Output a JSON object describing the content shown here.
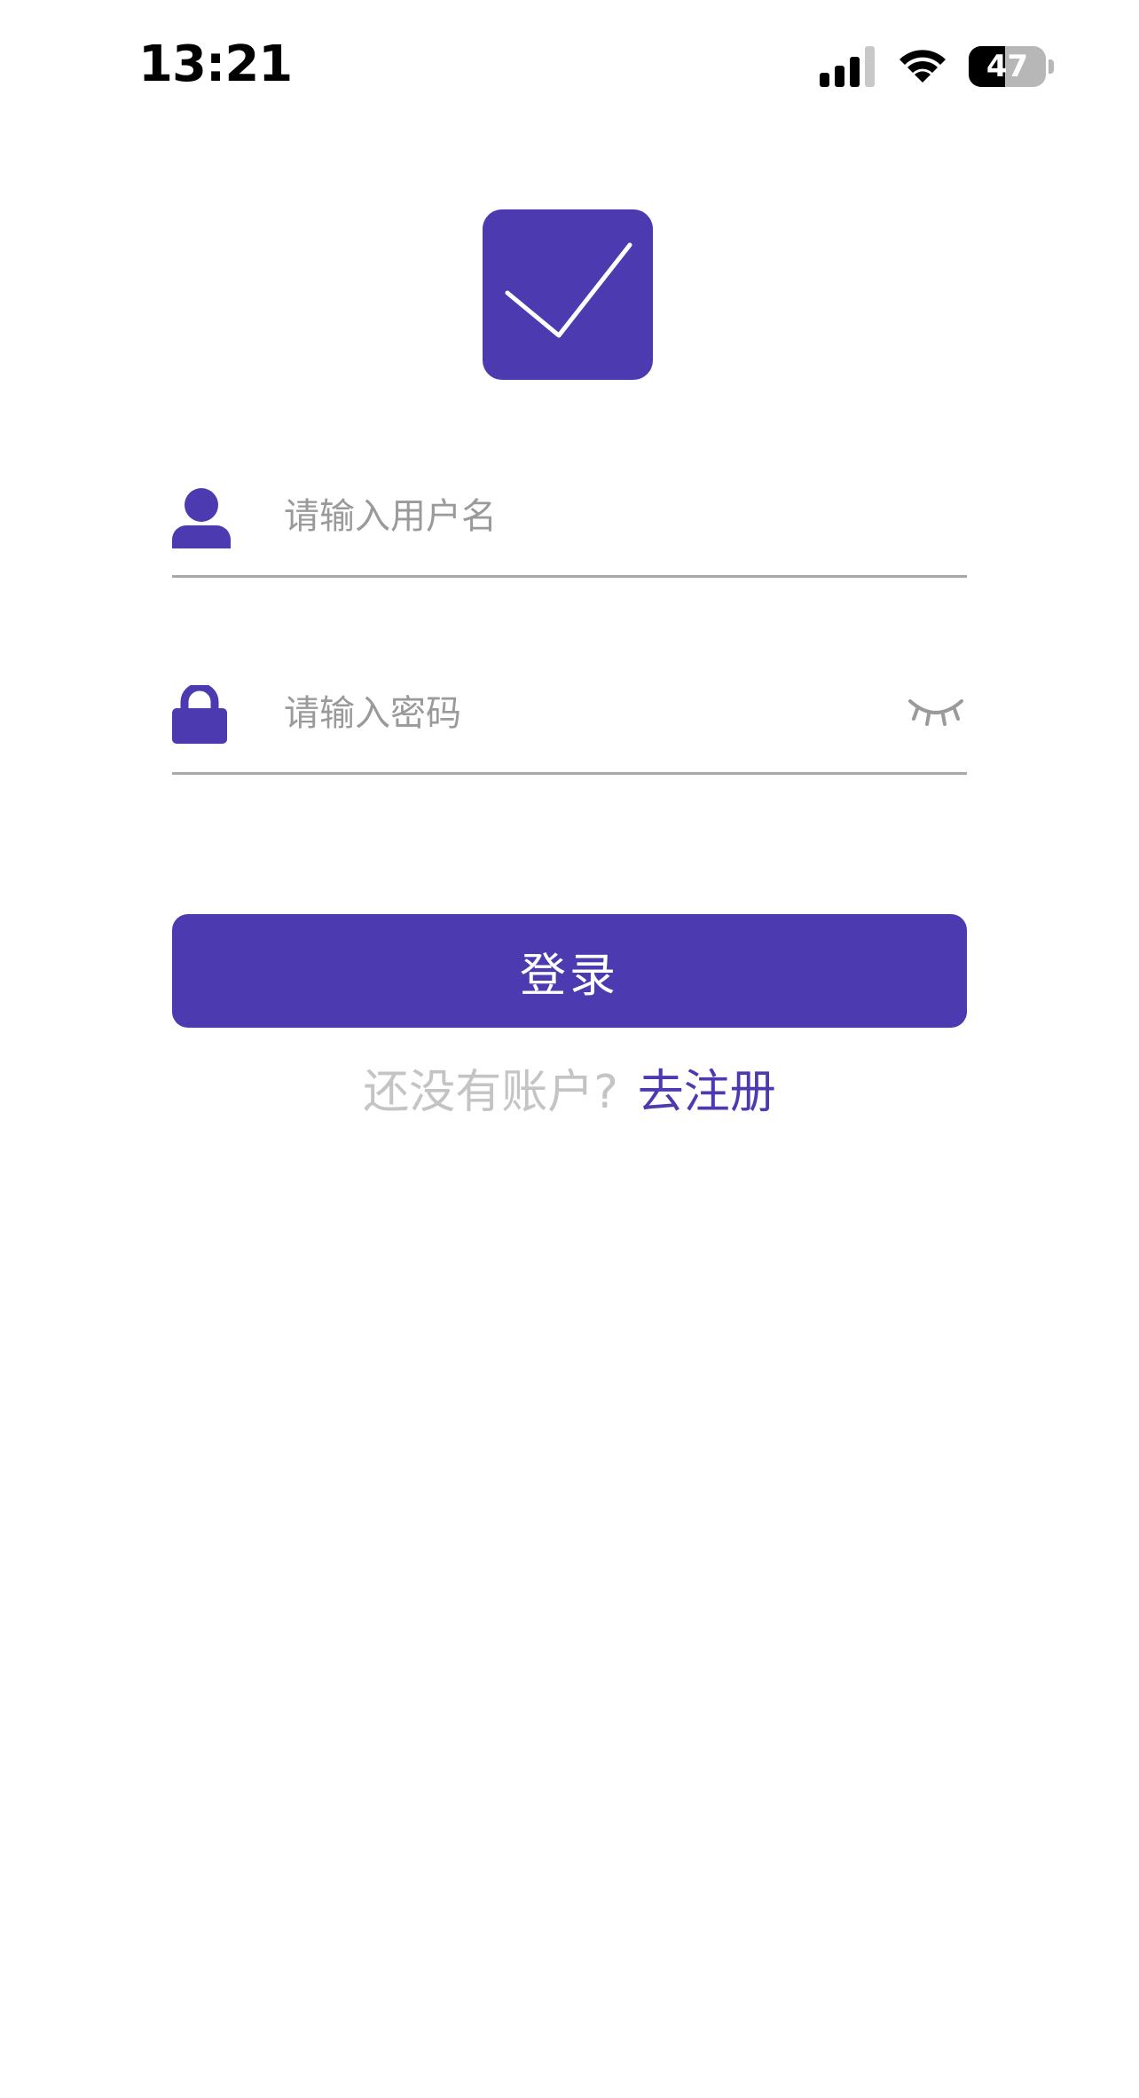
{
  "status_bar": {
    "time": "13:21",
    "battery_level": "47",
    "battery_fraction": 0.47,
    "signal_bars_active": 3,
    "signal_bars_total": 4
  },
  "logo": {
    "icon": "checkmark-icon",
    "color": "#4c3bb0"
  },
  "form": {
    "username": {
      "icon": "user-icon",
      "placeholder": "请输入用户名",
      "value": ""
    },
    "password": {
      "icon": "lock-icon",
      "placeholder": "请输入密码",
      "value": "",
      "toggle_icon": "eye-closed-icon"
    }
  },
  "login_button": {
    "label": "登录",
    "color": "#4c3bb0"
  },
  "register": {
    "prompt": "还没有账户?",
    "link_label": "去注册"
  }
}
